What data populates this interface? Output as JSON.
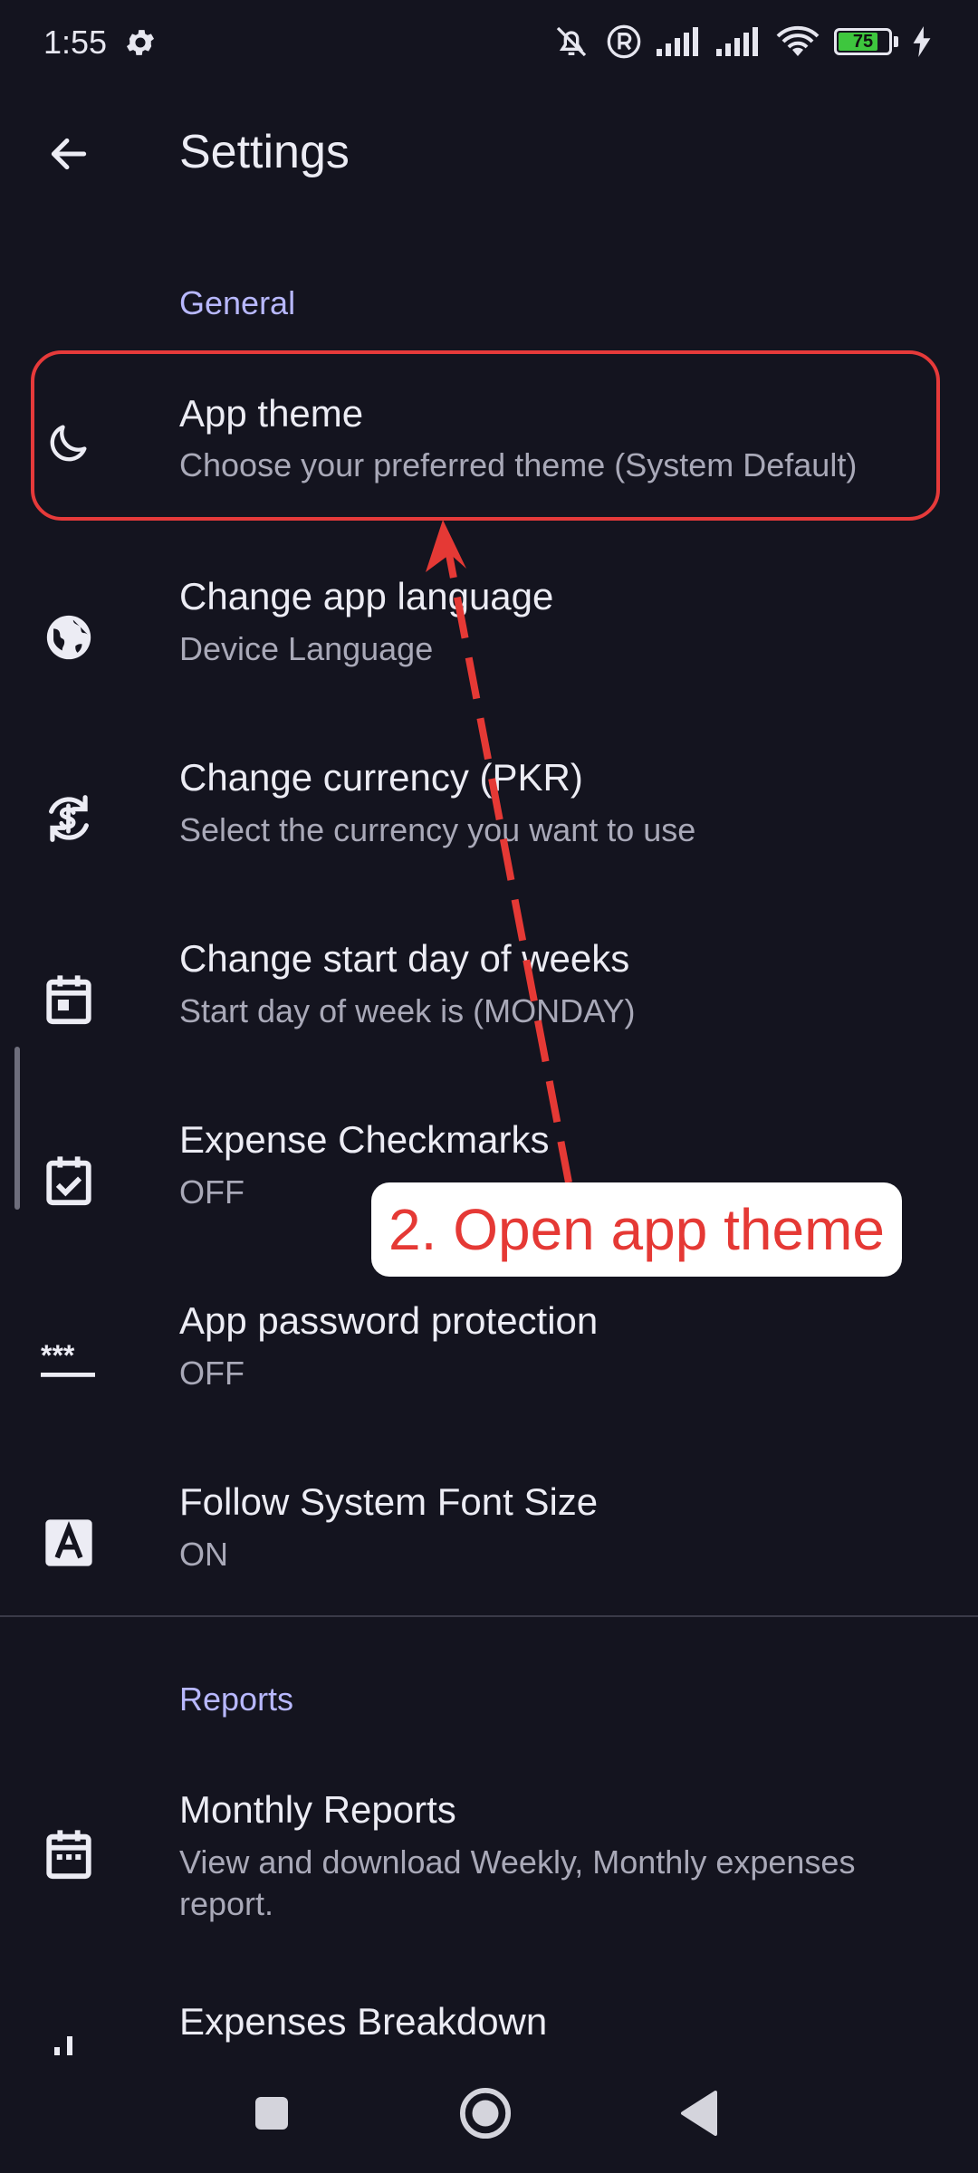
{
  "status": {
    "time": "1:55",
    "battery": "75",
    "icons": [
      "gear-icon",
      "bell-off-icon",
      "registered-icon",
      "signal-icon",
      "signal-icon",
      "wifi-icon",
      "battery-icon",
      "charging-icon"
    ]
  },
  "header": {
    "title": "Settings",
    "back_icon": "arrow-left-icon"
  },
  "sections": {
    "general": {
      "header": "General",
      "items": [
        {
          "title": "App theme",
          "subtitle": "Choose your preferred theme (System Default)",
          "icon": "moon-icon"
        },
        {
          "title": "Change app language",
          "subtitle": "Device Language",
          "icon": "globe-icon"
        },
        {
          "title": "Change currency (PKR)",
          "subtitle": "Select the currency you want to use",
          "icon": "currency-exchange-icon"
        },
        {
          "title": "Change start day of weeks",
          "subtitle": "Start day of week is (MONDAY)",
          "icon": "calendar-icon"
        },
        {
          "title": "Expense Checkmarks",
          "subtitle": "OFF",
          "icon": "checkbox-calendar-icon"
        },
        {
          "title": "App password protection",
          "subtitle": "OFF",
          "icon": "password-icon"
        },
        {
          "title": "Follow System Font Size",
          "subtitle": "ON",
          "icon": "font-size-icon"
        }
      ]
    },
    "reports": {
      "header": "Reports",
      "items": [
        {
          "title": "Monthly Reports",
          "subtitle": "View and download Weekly, Monthly expenses report.",
          "icon": "calendar-month-icon"
        },
        {
          "title": "Expenses Breakdown",
          "icon": "bar-chart-icon"
        }
      ]
    }
  },
  "annotation": {
    "label": "2. Open app theme",
    "color": "#e53935"
  },
  "navbar": {
    "icons": [
      "recents-square-icon",
      "home-circle-icon",
      "back-triangle-icon"
    ]
  },
  "colors": {
    "background": "#14141f",
    "accent": "#b8b8ff",
    "annotation": "#e53935"
  }
}
